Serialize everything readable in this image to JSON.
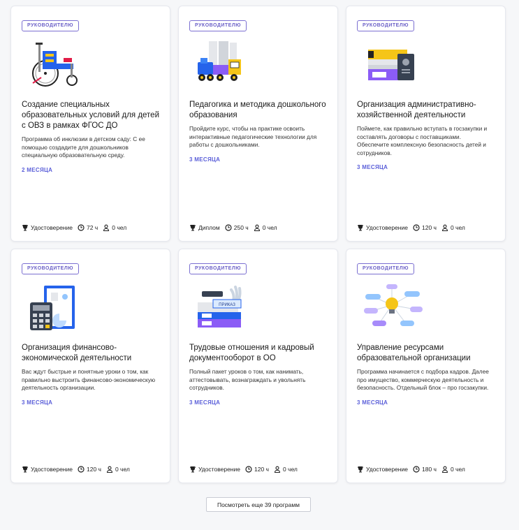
{
  "cards": [
    {
      "badge": "РУКОВОДИТЕЛЮ",
      "title": "Создание специальных образовательных условий для детей с ОВЗ в рамках ФГОС ДО",
      "description": "Программа об инклюзии в детском саду: С ее помощью создадите для дошкольников специальную образовательную среду.",
      "duration": "2 МЕСЯЦА",
      "document": "Удостоверение",
      "hours": "72 ч",
      "students": "0 чел",
      "illustration": "wheelchair-icon"
    },
    {
      "badge": "РУКОВОДИТЕЛЮ",
      "title": "Педагогика и методика дошкольного образования",
      "description": "Пройдите курс, чтобы на практике освоить интерактивные педагогические технологии для работы с дошкольниками.",
      "duration": "3 МЕСЯЦА",
      "document": "Диплом",
      "hours": "250 ч",
      "students": "0 чел",
      "illustration": "toy-train-icon"
    },
    {
      "badge": "РУКОВОДИТЕЛЮ",
      "title": "Организация административно-хозяйственной деятельности",
      "description": "Поймете, как правильно вступать в госзакупки и составлять договоры с поставщиками. Обеспечите комплексную безопасность детей и сотрудников.",
      "duration": "3 МЕСЯЦА",
      "document": "Удостоверение",
      "hours": "120 ч",
      "students": "0 чел",
      "illustration": "binders-icon"
    },
    {
      "badge": "РУКОВОДИТЕЛЮ",
      "title": "Организация финансово-экономической деятельности",
      "description": "Вас ждут быстрые и понятные уроки о том, как правильно выстроить финансово-экономическую деятельность организации.",
      "duration": "3 МЕСЯЦА",
      "document": "Удостоверение",
      "hours": "120 ч",
      "students": "0 чел",
      "illustration": "calculator-icon"
    },
    {
      "badge": "РУКОВОДИТЕЛЮ",
      "title": "Трудовые отношения и кадровый документооборот в ОО",
      "description": "Полный пакет уроков о том, как нанимать, аттестовывать, вознаграждать и увольнять сотрудников.",
      "duration": "3 МЕСЯЦА",
      "document": "Удостоверение",
      "hours": "120 ч",
      "students": "0 чел",
      "illustration": "order-folders-icon",
      "prikaz_label": "ПРИКАЗ"
    },
    {
      "badge": "РУКОВОДИТЕЛЮ",
      "title": "Управление ресурсами образовательной организации",
      "description": "Программа начинается с подбора кадров. Далее про имущество, коммерческую деятельность и безопасность. Отдельный блок – про госзакупки.",
      "duration": "3 МЕСЯЦА",
      "document": "Удостоверение",
      "hours": "180 ч",
      "students": "0 чел",
      "illustration": "lightbulb-mindmap-icon"
    }
  ],
  "more_button": "Посмотреть еще 39 программ",
  "colors": {
    "accent": "#5b5fd9",
    "badge": "#6a5fc7",
    "yellow": "#f5c518",
    "purple": "#8b5cf6",
    "blue": "#2563eb"
  }
}
